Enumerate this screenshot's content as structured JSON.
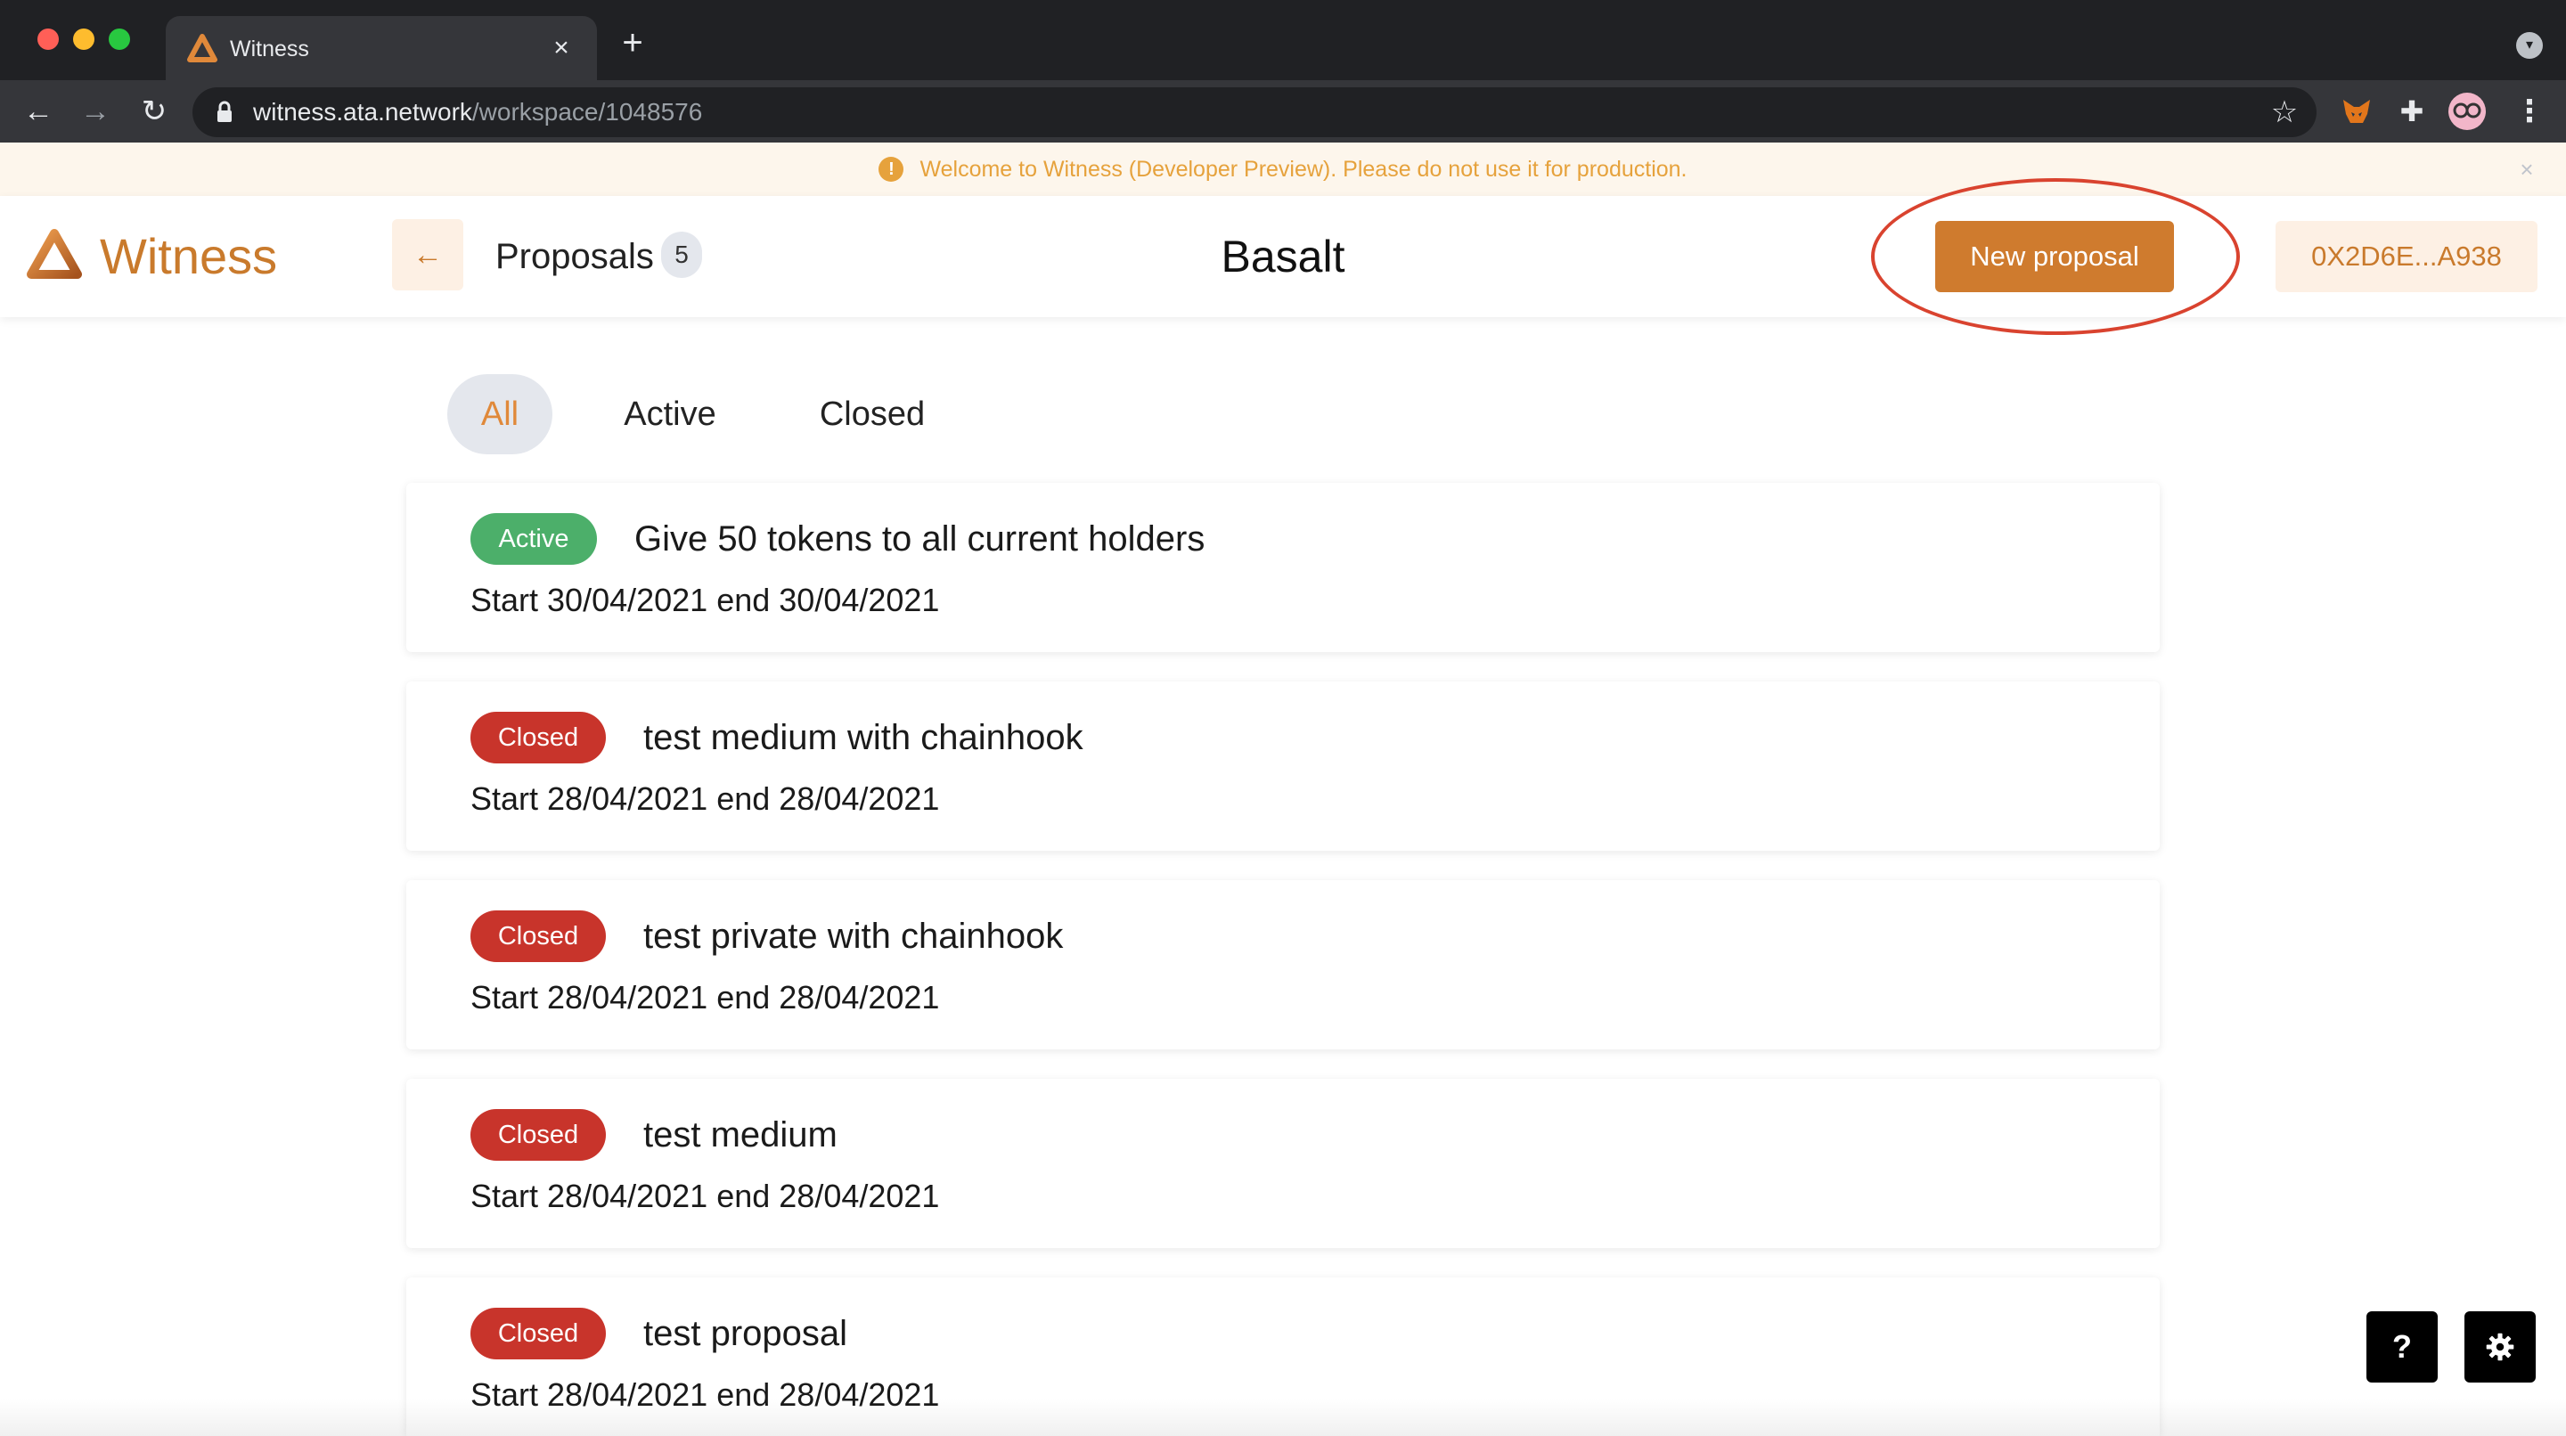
{
  "browser": {
    "tab_title": "Witness",
    "tab_close": "×",
    "new_tab": "+",
    "url_host": "witness.ata.network",
    "url_path": "/workspace/1048576"
  },
  "banner": {
    "icon": "!",
    "text": "Welcome to Witness (Developer Preview). Please do not use it for production.",
    "close": "×"
  },
  "header": {
    "logo_text": "Witness",
    "back_label": "←",
    "proposals_label": "Proposals",
    "proposals_count": "5",
    "title": "Basalt",
    "new_proposal_label": "New proposal",
    "wallet_label": "0X2D6E...A938"
  },
  "filters": [
    {
      "label": "All",
      "active": true
    },
    {
      "label": "Active",
      "active": false
    },
    {
      "label": "Closed",
      "active": false
    }
  ],
  "proposals": [
    {
      "status": "Active",
      "title": "Give 50 tokens to all current holders",
      "dates": "Start 30/04/2021 end 30/04/2021"
    },
    {
      "status": "Closed",
      "title": "test medium with chainhook",
      "dates": "Start 28/04/2021 end 28/04/2021"
    },
    {
      "status": "Closed",
      "title": "test private with chainhook",
      "dates": "Start 28/04/2021 end 28/04/2021"
    },
    {
      "status": "Closed",
      "title": "test medium",
      "dates": "Start 28/04/2021 end 28/04/2021"
    },
    {
      "status": "Closed",
      "title": "test proposal",
      "dates": "Start 28/04/2021 end 28/04/2021"
    }
  ],
  "floating": {
    "help_label": "?",
    "settings_icon": "gear-icon"
  },
  "colors": {
    "brand": "#cf7b2e",
    "active_status": "#4caf6a",
    "closed_status": "#c8342b",
    "banner_text": "#e6a23c",
    "annotation_ring": "#d9432f"
  }
}
